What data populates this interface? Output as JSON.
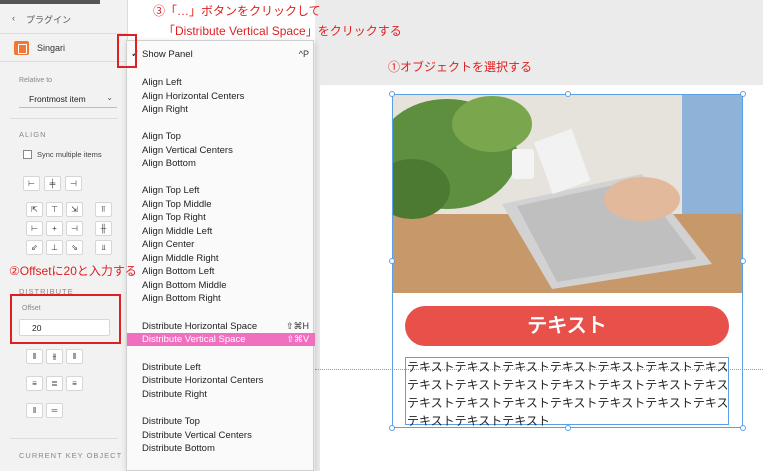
{
  "left_panel": {
    "back_label": "プラグイン",
    "plugin_name": "Singari",
    "relative_to_label": "Relative to",
    "relative_to_value": "Frontmost item",
    "align_header": "ALIGN",
    "sync_label": "Sync multiple items",
    "distribute_header": "DISTRIBUTE",
    "offset_label": "Offset",
    "offset_value": "20",
    "current_key_header": "CURRENT KEY OBJECT"
  },
  "menu": {
    "show_panel": "Show Panel",
    "show_panel_shortcut": "^P",
    "items": [
      "Align Left",
      "Align Horizontal Centers",
      "Align Right",
      "Align Top",
      "Align Vertical Centers",
      "Align Bottom",
      "Align Top Left",
      "Align Top Middle",
      "Align Top Right",
      "Align Middle Left",
      "Align Center",
      "Align Middle Right",
      "Align Bottom Left",
      "Align Bottom Middle",
      "Align Bottom Right",
      "Distribute Horizontal Space",
      "Distribute Vertical Space",
      "Distribute Left",
      "Distribute Horizontal Centers",
      "Distribute Right",
      "Distribute Top",
      "Distribute Vertical Centers",
      "Distribute Bottom"
    ],
    "shortcut_horizontal_space": "⇧⌘H",
    "shortcut_vertical_space": "⇧⌘V"
  },
  "annotations": {
    "step1": "①オブジェクトを選択する",
    "step2": "②Offsetに20と入力する",
    "step3_line1": "③「…」ボタンをクリックして",
    "step3_line2": "「Distribute Vertical Space」をクリックする"
  },
  "artboard": {
    "button_label": "テキスト",
    "text_lines": [
      "テキストテキストテキストテキストテキストテキストテキスト",
      "テキストテキストテキストテキストテキストテキストテキスト",
      "テキストテキストテキストテキストテキストテキストテキスト",
      "テキストテキストテキスト"
    ]
  },
  "colors": {
    "highlight": "#f070c0",
    "annotation_red": "#e02020",
    "button_red": "#e8504a",
    "selection_blue": "#5aa0e8",
    "plugin_orange": "#f07834"
  }
}
